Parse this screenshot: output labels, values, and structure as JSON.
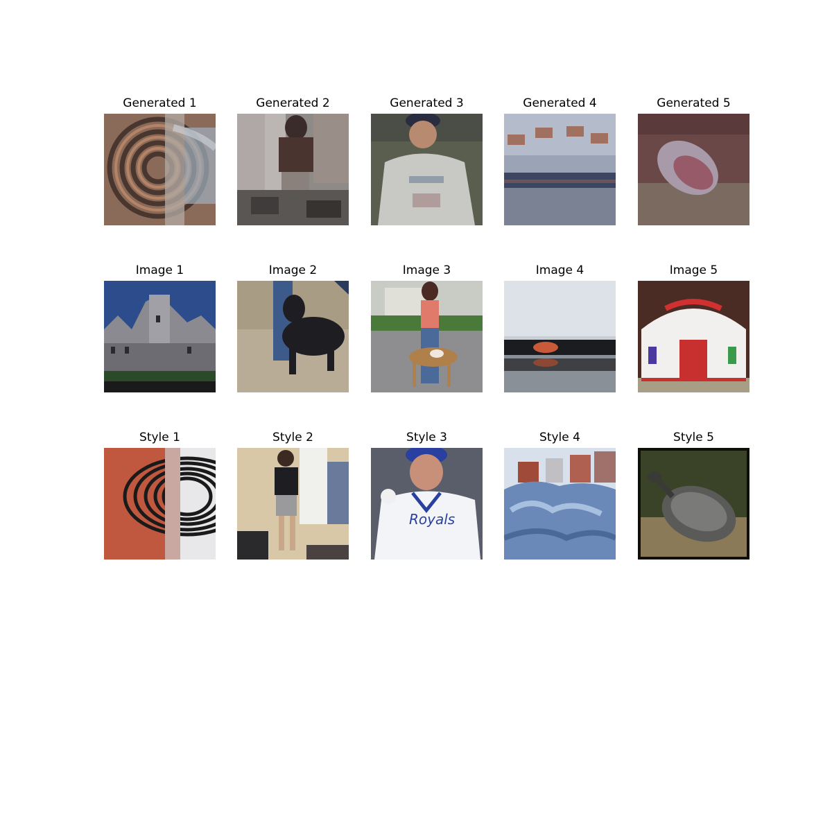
{
  "rows": [
    {
      "name": "generated",
      "titles": [
        "Generated 1",
        "Generated 2",
        "Generated 3",
        "Generated 4",
        "Generated 5"
      ]
    },
    {
      "name": "image",
      "titles": [
        "Image 1",
        "Image 2",
        "Image 3",
        "Image 4",
        "Image 5"
      ]
    },
    {
      "name": "style",
      "titles": [
        "Style 1",
        "Style 2",
        "Style 3",
        "Style 4",
        "Style 5"
      ]
    }
  ],
  "image_text": {
    "style3_jersey": "Royals"
  }
}
